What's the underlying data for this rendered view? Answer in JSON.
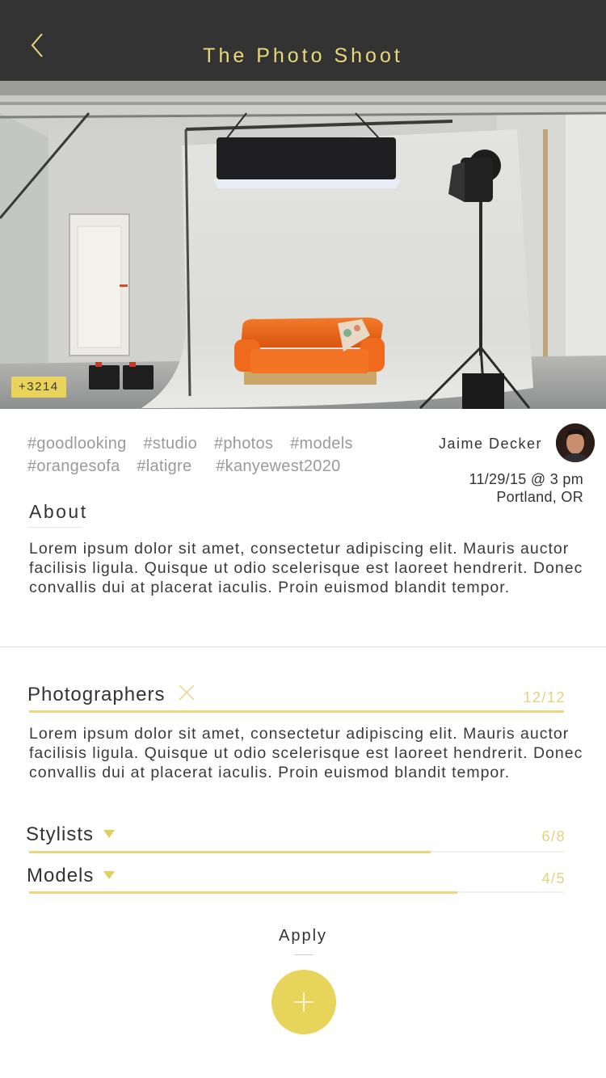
{
  "header": {
    "title": "The Photo Shoot",
    "back_icon": "chevron-left-icon"
  },
  "hero": {
    "badge": "+3214"
  },
  "event": {
    "tags_row1": [
      "#goodlooking",
      "#studio",
      "#photos",
      "#models"
    ],
    "tags_row2": [
      "#orangesofa",
      "#latigre",
      "#kanyewest2020"
    ],
    "author": "Jaime Decker",
    "date": "11/29/15 @ 3 pm",
    "location": "Portland, OR"
  },
  "about": {
    "heading": "About",
    "body": "Lorem ipsum dolor sit amet, consectetur adipiscing elit. Mauris auctor facilisis ligula. Quisque ut odio scelerisque est laoreet hendrerit. Donec convallis dui at placerat iaculis. Proin euismod blandit tempor."
  },
  "roles": {
    "photographers": {
      "label": "Photographers",
      "count": "12/12",
      "fill": 1.0,
      "body": "Lorem ipsum dolor sit amet, consectetur adipiscing elit. Mauris auctor facilisis ligula. Quisque ut odio scelerisque est laoreet hendrerit. Donec convallis dui at placerat iaculis. Proin euismod blandit tempor."
    },
    "stylists": {
      "label": "Stylists",
      "count": "6/8",
      "fill": 0.75
    },
    "models": {
      "label": "Models",
      "count": "4/5",
      "fill": 0.8
    }
  },
  "actions": {
    "apply": "Apply",
    "add_icon": "plus-icon"
  },
  "colors": {
    "accent": "#e7d45a",
    "header_bg": "#333333",
    "title": "#e9d87a",
    "badge": "#e9d35a",
    "sofa": "#f06a1c"
  }
}
